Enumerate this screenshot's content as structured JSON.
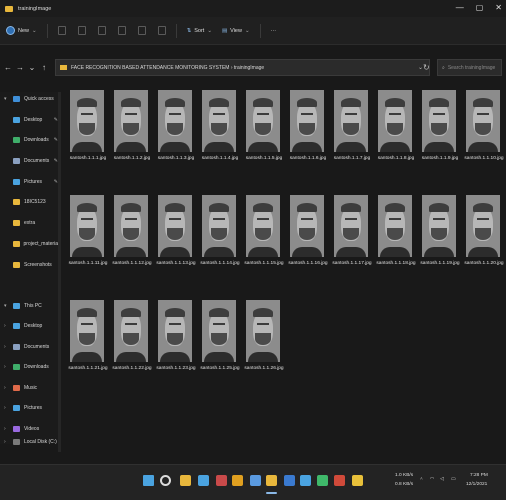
{
  "window": {
    "title": "trainingImage",
    "minimize_glyph": "—",
    "maximize_glyph": "▢",
    "close_glyph": "✕"
  },
  "toolbar": {
    "new_label": "New",
    "sort_label": "Sort",
    "view_label": "View",
    "more_label": "···"
  },
  "address_bar": {
    "path": "FACE RECOGNITION BASED ATTENDANCE MONITORING SYSTEM  ›  trainingImage",
    "search_placeholder": "Search trainingImage"
  },
  "sidebar": {
    "items": [
      {
        "label": "Quick access",
        "icon": "star-icon",
        "color": "#3f8fd8",
        "chevron": "▾"
      },
      {
        "label": "Desktop",
        "icon": "desktop-icon",
        "color": "#4aa3e0",
        "pin": "✎"
      },
      {
        "label": "Downloads",
        "icon": "download-icon",
        "color": "#3fae6a",
        "pin": "✎"
      },
      {
        "label": "Documents",
        "icon": "documents-icon",
        "color": "#8aa0c0",
        "pin": "✎"
      },
      {
        "label": "Pictures",
        "icon": "pictures-icon",
        "color": "#4aa3e0",
        "pin": "✎"
      },
      {
        "label": "18IC5123",
        "icon": "folder-icon",
        "color": "#e8b73c"
      },
      {
        "label": "extra",
        "icon": "folder-icon",
        "color": "#e8b73c"
      },
      {
        "label": "project_materia",
        "icon": "folder-icon",
        "color": "#e8b73c"
      },
      {
        "label": "Screenshots",
        "icon": "folder-icon",
        "color": "#e8b73c"
      },
      {
        "label": "This PC",
        "icon": "computer-icon",
        "color": "#4aa3e0",
        "chevron": "▾"
      },
      {
        "label": "Desktop",
        "icon": "desktop-icon",
        "color": "#4aa3e0",
        "chevron": "›"
      },
      {
        "label": "Documents",
        "icon": "documents-icon",
        "color": "#8aa0c0",
        "chevron": "›"
      },
      {
        "label": "Downloads",
        "icon": "download-icon",
        "color": "#3fae6a",
        "chevron": "›"
      },
      {
        "label": "Music",
        "icon": "music-icon",
        "color": "#e06a4a",
        "chevron": "›"
      },
      {
        "label": "Pictures",
        "icon": "pictures-icon",
        "color": "#4aa3e0",
        "chevron": "›"
      },
      {
        "label": "Videos",
        "icon": "videos-icon",
        "color": "#9a6ae0",
        "chevron": "›"
      },
      {
        "label": "Local Disk (C:)",
        "icon": "drive-icon",
        "color": "#7a7a7a",
        "chevron": "›"
      }
    ]
  },
  "files": [
    {
      "name": "santosh.1.1.1.jpg"
    },
    {
      "name": "santosh.1.1.2.jpg"
    },
    {
      "name": "santosh.1.1.3.jpg"
    },
    {
      "name": "santosh.1.1.4.jpg"
    },
    {
      "name": "santosh.1.1.5.jpg"
    },
    {
      "name": "santosh.1.1.6.jpg"
    },
    {
      "name": "santosh.1.1.7.jpg"
    },
    {
      "name": "santosh.1.1.8.jpg"
    },
    {
      "name": "santosh.1.1.9.jpg"
    },
    {
      "name": "santosh.1.1.10.jpg"
    },
    {
      "name": "santosh.1.1.11.jpg"
    },
    {
      "name": "santosh.1.1.12.jpg"
    },
    {
      "name": "santosh.1.1.13.jpg"
    },
    {
      "name": "santosh.1.1.14.jpg"
    },
    {
      "name": "santosh.1.1.15.jpg"
    },
    {
      "name": "santosh.1.1.16.jpg"
    },
    {
      "name": "santosh.1.1.17.jpg"
    },
    {
      "name": "santosh.1.1.18.jpg"
    },
    {
      "name": "santosh.1.1.19.jpg"
    },
    {
      "name": "santosh.1.1.20.jpg"
    },
    {
      "name": "santosh.1.1.21.jpg"
    },
    {
      "name": "santosh.1.1.22.jpg"
    },
    {
      "name": "santosh.1.1.23.jpg"
    },
    {
      "name": "santosh.1.1.25.jpg"
    },
    {
      "name": "santosh.1.1.26.jpg"
    }
  ],
  "taskbar": {
    "icons": [
      {
        "name": "windows-start-icon",
        "color": "#4aa3e0"
      },
      {
        "name": "search-icon",
        "color": "#dcdcdc"
      },
      {
        "name": "file-explorer-icon",
        "color": "#e8b73c"
      },
      {
        "name": "app-icon-1",
        "color": "#4aa3e0"
      },
      {
        "name": "app-icon-2",
        "color": "#c94a4a"
      },
      {
        "name": "chrome-icon",
        "color": "#e0a020"
      },
      {
        "name": "app-icon-3",
        "color": "#5a9ae0"
      },
      {
        "name": "folder-icon",
        "color": "#e8b73c"
      },
      {
        "name": "app-icon-4",
        "color": "#3a7ad0"
      },
      {
        "name": "app-icon-5",
        "color": "#4aa3e0"
      },
      {
        "name": "whatsapp-icon",
        "color": "#3fb86a"
      },
      {
        "name": "app-icon-6",
        "color": "#d04a3a"
      },
      {
        "name": "app-icon-7",
        "color": "#e8c03a"
      }
    ],
    "network_up": "1.0 KB/s",
    "network_down": "0.8 KB/s",
    "time": "7:28 PM",
    "date": "12/1/2021"
  }
}
